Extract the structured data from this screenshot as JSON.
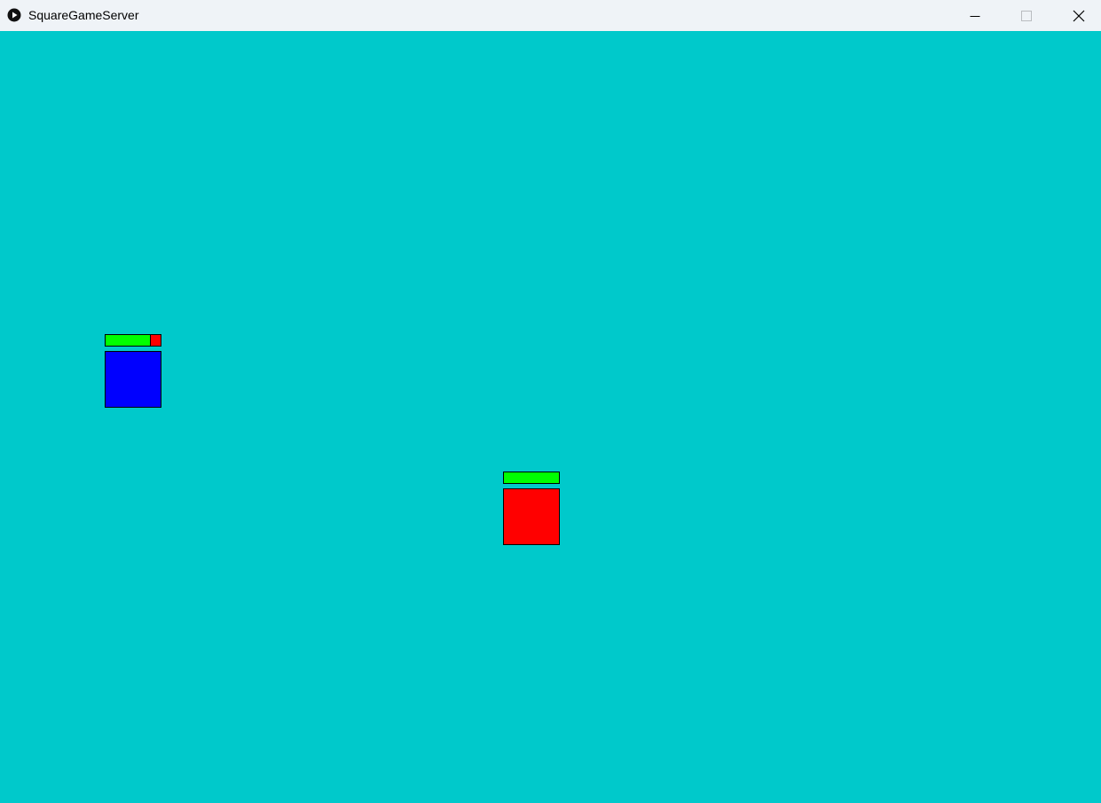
{
  "window": {
    "title": "SquareGameServer",
    "background_color": "#00c9cb",
    "icons": {
      "app": "play-circle-icon",
      "minimize": "minimize-icon",
      "maximize": "maximize-icon",
      "close": "close-icon"
    }
  },
  "players": [
    {
      "id": "blue",
      "color": "#0000ff",
      "health_fraction": 0.82,
      "health_color": "#00ff00",
      "damage_color": "#ff0000"
    },
    {
      "id": "red",
      "color": "#ff0000",
      "health_fraction": 1.0,
      "health_color": "#00ff00",
      "damage_color": "#ff0000"
    }
  ]
}
